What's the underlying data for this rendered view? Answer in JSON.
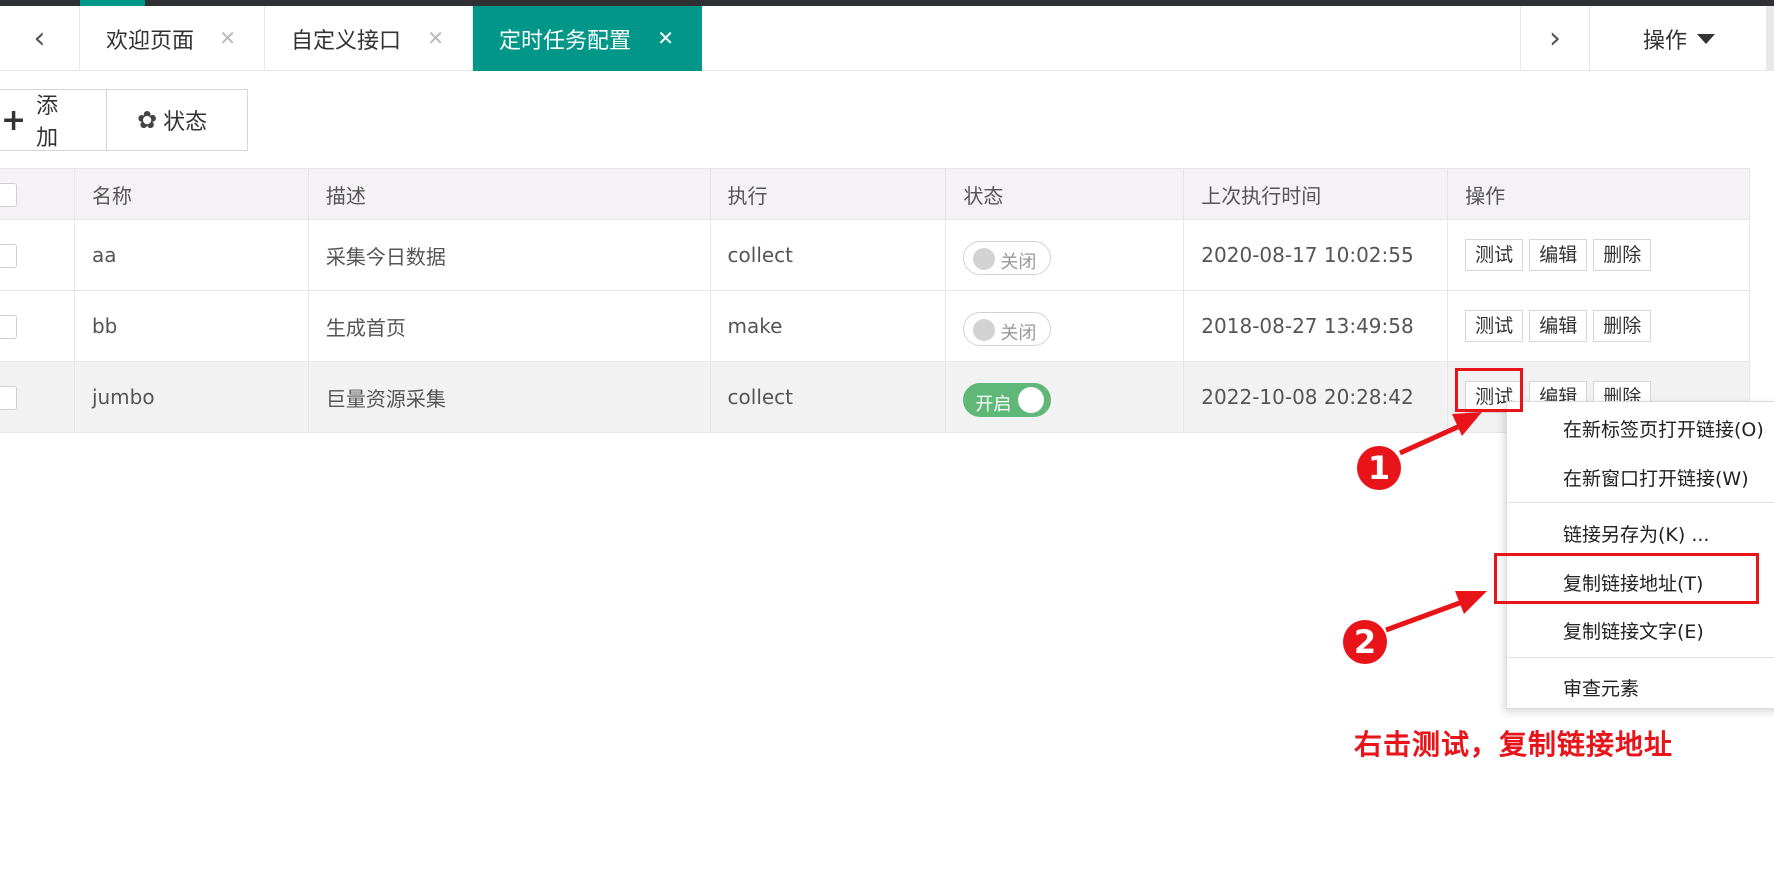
{
  "tabs": [
    {
      "label": "欢迎页面",
      "close": "✕"
    },
    {
      "label": "自定义接口",
      "close": "✕"
    },
    {
      "label": "定时任务配置",
      "close": "✕"
    }
  ],
  "nav": {
    "prev": "‹",
    "next": "›",
    "ops_label": "操作"
  },
  "toolbar": {
    "add_label": "添加",
    "state_label": "状态"
  },
  "table": {
    "headers": [
      "名称",
      "描述",
      "执行",
      "状态",
      "上次执行时间",
      "操作"
    ],
    "rows": [
      {
        "name": "aa",
        "desc": "采集今日数据",
        "exec": "collect",
        "status": "关闭",
        "time": "2020-08-17 10:02:55"
      },
      {
        "name": "bb",
        "desc": "生成首页",
        "exec": "make",
        "status": "关闭",
        "time": "2018-08-27 13:49:58"
      },
      {
        "name": "jumbo",
        "desc": "巨量资源采集",
        "exec": "collect",
        "status": "开启",
        "time": "2022-10-08 20:28:42"
      }
    ],
    "actions": {
      "test": "测试",
      "edit": "编辑",
      "delete": "删除"
    }
  },
  "context_menu": {
    "items": [
      "在新标签页打开链接(O)",
      "在新窗口打开链接(W)",
      "链接另存为(K) ...",
      "复制链接地址(T)",
      "复制链接文字(E)",
      "审查元素"
    ]
  },
  "annotation": {
    "step1": "1",
    "step2": "2",
    "caption": "右击测试，复制链接地址",
    "color": "#e8141a"
  },
  "colors": {
    "active_tab": "#009688",
    "switch_on": "#5fb878"
  }
}
